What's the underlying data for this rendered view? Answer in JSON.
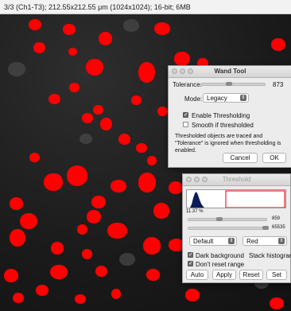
{
  "info_bar": {
    "text": "3/3 (Ch1-T3); 212.55x212.55 μm (1024x1024); 16-bit; 6MB"
  },
  "wand_tool": {
    "title": "Wand Tool",
    "tolerance_label": "Tolerance:",
    "tolerance_value": "873",
    "mode_label": "Mode:",
    "mode_value": "Legacy",
    "enable_thresholding_label": "Enable Thresholding",
    "enable_thresholding_checked": true,
    "smooth_label": "Smooth if thresholded",
    "smooth_checked": false,
    "note": "Thresholded objects are traced and \"Tolerance\" is ignored when thresholding is enabled.",
    "cancel_label": "Cancel",
    "ok_label": "OK"
  },
  "threshold": {
    "title": "Threshold",
    "percent": "11.37 %",
    "lower_value": "859",
    "upper_value": "65535",
    "method_value": "Default",
    "display_value": "Red",
    "dark_background_label": "Dark background",
    "dark_background_checked": true,
    "stack_histogram_label": "Stack histogram",
    "dont_reset_label": "Don't reset range",
    "dont_reset_checked": true,
    "auto_label": "Auto",
    "apply_label": "Apply",
    "reset_label": "Reset",
    "set_label": "Set"
  },
  "colors": {
    "mask": "#ff0000",
    "histogram": "#0a1a5a",
    "threshold_box": "#d00000"
  },
  "icons": [
    "traffic-light-icon",
    "chevron-updown-icon",
    "checkmark-icon"
  ]
}
